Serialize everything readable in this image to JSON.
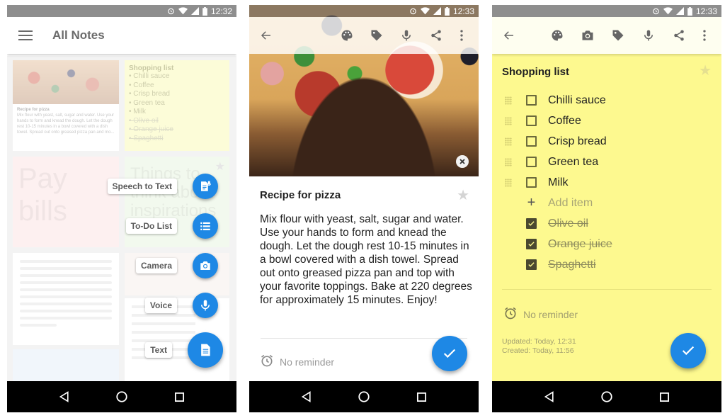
{
  "screens": [
    {
      "status": {
        "time": "12:32"
      },
      "appbar": {
        "title": "All Notes"
      },
      "cards": {
        "pizza": {
          "title": "Recipe for pizza",
          "snippet": "Mix flour with yeast, salt, sugar and water. Use your hands to form and knead the dough. Let the dough rest 10-15 minutes in a bowl covered with a dish towel. Spread out onto greased pizza pan and mo..."
        },
        "shopping": {
          "title": "Shopping list",
          "items": [
            "Chilli sauce",
            "Coffee",
            "Crisp bread",
            "Green tea",
            "Milk"
          ],
          "done_items": [
            "Olive oil",
            "Orange juice",
            "Spaghetti"
          ]
        },
        "pay": {
          "text": "Pay bills"
        },
        "things": {
          "text": "Things to think about inspirations"
        }
      },
      "fab_menu": [
        {
          "label": "Speech to Text",
          "icon": "speech-to-text-icon"
        },
        {
          "label": "To-Do List",
          "icon": "list-icon"
        },
        {
          "label": "Camera",
          "icon": "camera-icon"
        },
        {
          "label": "Voice",
          "icon": "mic-icon"
        },
        {
          "label": "Text",
          "icon": "document-icon"
        }
      ]
    },
    {
      "status": {
        "time": "12:33"
      },
      "toolbar": [
        "back",
        "palette",
        "tag",
        "mic",
        "share",
        "more"
      ],
      "note": {
        "title": "Recipe for pizza",
        "body": "Mix flour with yeast, salt, sugar and water. Use your hands to form and knead the dough. Let the dough rest 10-15 minutes in a bowl covered with a dish towel. Spread out onto greased pizza pan and top with your favorite toppings. Bake at 220 degrees for approximately 15 minutes. Enjoy!",
        "starred": false
      },
      "reminder": "No reminder"
    },
    {
      "status": {
        "time": "12:33"
      },
      "toolbar": [
        "back",
        "palette",
        "camera",
        "tag",
        "mic",
        "share",
        "more"
      ],
      "note": {
        "title": "Shopping list",
        "starred": false,
        "items": [
          {
            "label": "Chilli sauce",
            "checked": false
          },
          {
            "label": "Coffee",
            "checked": false
          },
          {
            "label": "Crisp bread",
            "checked": false
          },
          {
            "label": "Green tea",
            "checked": false
          },
          {
            "label": "Milk",
            "checked": false
          }
        ],
        "add_item_placeholder": "Add item",
        "checked_items": [
          {
            "label": "Olive oil",
            "checked": true
          },
          {
            "label": "Orange juice",
            "checked": true
          },
          {
            "label": "Spaghetti",
            "checked": true
          }
        ]
      },
      "reminder": "No reminder",
      "meta": {
        "updated": "Updated: Today, 12:31",
        "created": "Created: Today, 11:56"
      }
    }
  ],
  "colors": {
    "accent": "#1e88e5",
    "yellow_note": "#fdf98f",
    "statusbar": "#8e8e8e"
  }
}
